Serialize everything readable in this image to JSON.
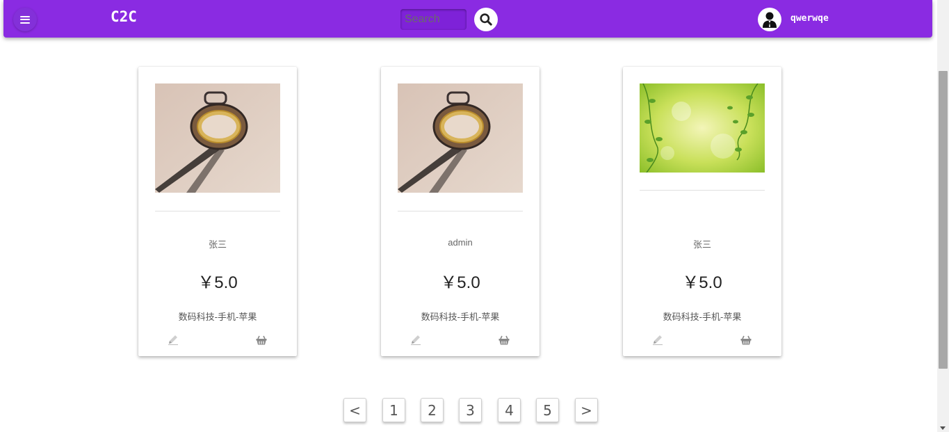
{
  "header": {
    "brand": "C2C",
    "search_placeholder": "Search",
    "username": "qwerwqe",
    "icons": {
      "menu": "menu-icon",
      "search": "search-icon",
      "avatar": "user-icon"
    }
  },
  "products": [
    {
      "seller": "张三",
      "price": "￥5.0",
      "category": "数码科技-手机-苹果",
      "image": "pocket-watch"
    },
    {
      "seller": "admin",
      "price": "￥5.0",
      "category": "数码科技-手机-苹果",
      "image": "pocket-watch"
    },
    {
      "seller": "张三",
      "price": "￥5.0",
      "category": "数码科技-手机-苹果",
      "image": "green-leaves"
    }
  ],
  "pagination": {
    "prev": "<",
    "pages": [
      "1",
      "2",
      "3",
      "4",
      "5"
    ],
    "next": ">"
  },
  "colors": {
    "primary": "#8a2be2"
  }
}
